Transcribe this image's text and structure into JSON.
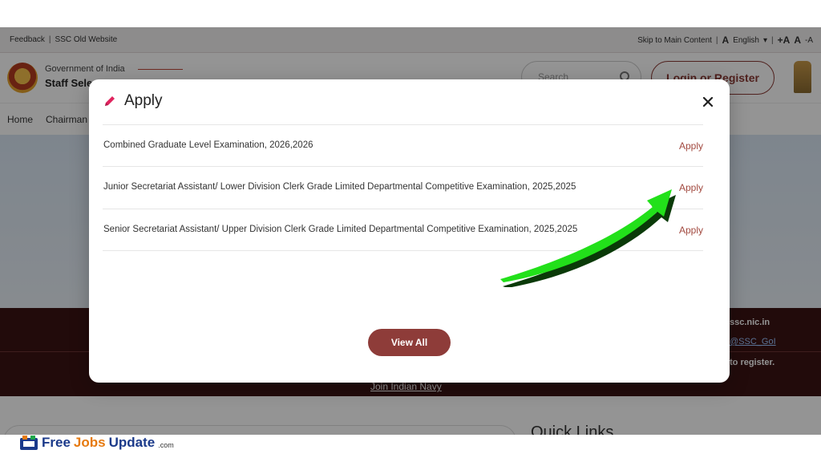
{
  "site": {
    "topbar": {
      "feedback": "Feedback",
      "old_website": "SSC Old Website",
      "skip": "Skip to Main Content",
      "language": "English",
      "font_large": "+A",
      "font_normal": "A",
      "font_small": "-A"
    },
    "header": {
      "gov": "Government of India",
      "org": "Staff Sele",
      "search_placeholder": "Search",
      "login": "Login or Register"
    },
    "nav": {
      "home": "Home",
      "chairman": "Chairman"
    },
    "banner": {
      "email": "ssc.nic.in",
      "twitter": "@SSC_GoI",
      "register": "to register.",
      "navy": "Join Indian Navy"
    },
    "quick_links": "Quick Links"
  },
  "modal": {
    "title": "Apply",
    "rows": [
      {
        "name": "Combined Graduate Level Examination, 2026,2026",
        "action": "Apply"
      },
      {
        "name": "Junior Secretariat Assistant/ Lower Division Clerk Grade Limited Departmental Competitive Examination, 2025,2025",
        "action": "Apply"
      },
      {
        "name": "Senior Secretariat Assistant/ Upper Division Clerk Grade Limited Departmental Competitive Examination, 2025,2025",
        "action": "Apply"
      }
    ],
    "view_all": "View All"
  },
  "watermark": {
    "free": "Free",
    "jobs": "Jobs",
    "update": "Update",
    "com": ".com"
  },
  "colors": {
    "accent": "#8e3c39",
    "apply_link": "#a24a40",
    "arrow": "#22e01a"
  }
}
